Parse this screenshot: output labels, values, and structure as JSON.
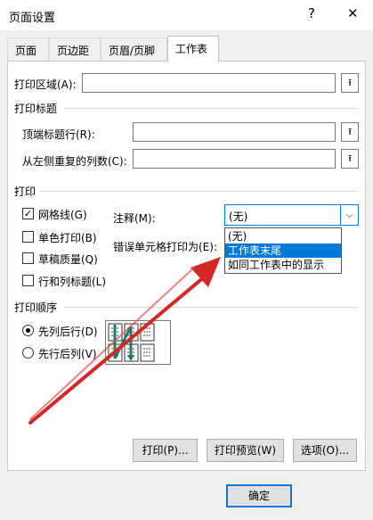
{
  "window": {
    "title": "页面设置",
    "help_glyph": "?",
    "close_glyph": "✕"
  },
  "tabs": [
    {
      "label": "页面"
    },
    {
      "label": "页边距"
    },
    {
      "label": "页眉/页脚"
    },
    {
      "label": "工作表"
    }
  ],
  "print_area": {
    "label": "打印区域(A):",
    "value": ""
  },
  "print_titles": {
    "heading": "打印标题",
    "rows_label": "顶端标题行(R):",
    "rows_value": "",
    "cols_label": "从左侧重复的列数(C):",
    "cols_value": ""
  },
  "print": {
    "heading": "打印",
    "gridlines": {
      "label": "网格线(G)",
      "checked": true
    },
    "black_white": {
      "label": "单色打印(B)",
      "checked": false
    },
    "draft": {
      "label": "草稿质量(Q)",
      "checked": false
    },
    "headings": {
      "label": "行和列标题(L)",
      "checked": false
    },
    "comments_label": "注释(M):",
    "comments_value": "(无)",
    "errors_label": "错误单元格打印为(E):",
    "comments_options": [
      "(无)",
      "工作表末尾",
      "如同工作表中的显示"
    ],
    "highlighted_option": "工作表末尾"
  },
  "page_order": {
    "heading": "打印顺序",
    "down_then_over": {
      "label": "先列后行(D)",
      "selected": true
    },
    "over_then_down": {
      "label": "先行后列(V)",
      "selected": false
    }
  },
  "buttons": {
    "print": "打印(P)...",
    "preview": "打印预览(W)",
    "options": "选项(O)...",
    "ok": "确定"
  },
  "colors": {
    "accent": "#0078d7",
    "annotation_arrow": "#d42626"
  }
}
